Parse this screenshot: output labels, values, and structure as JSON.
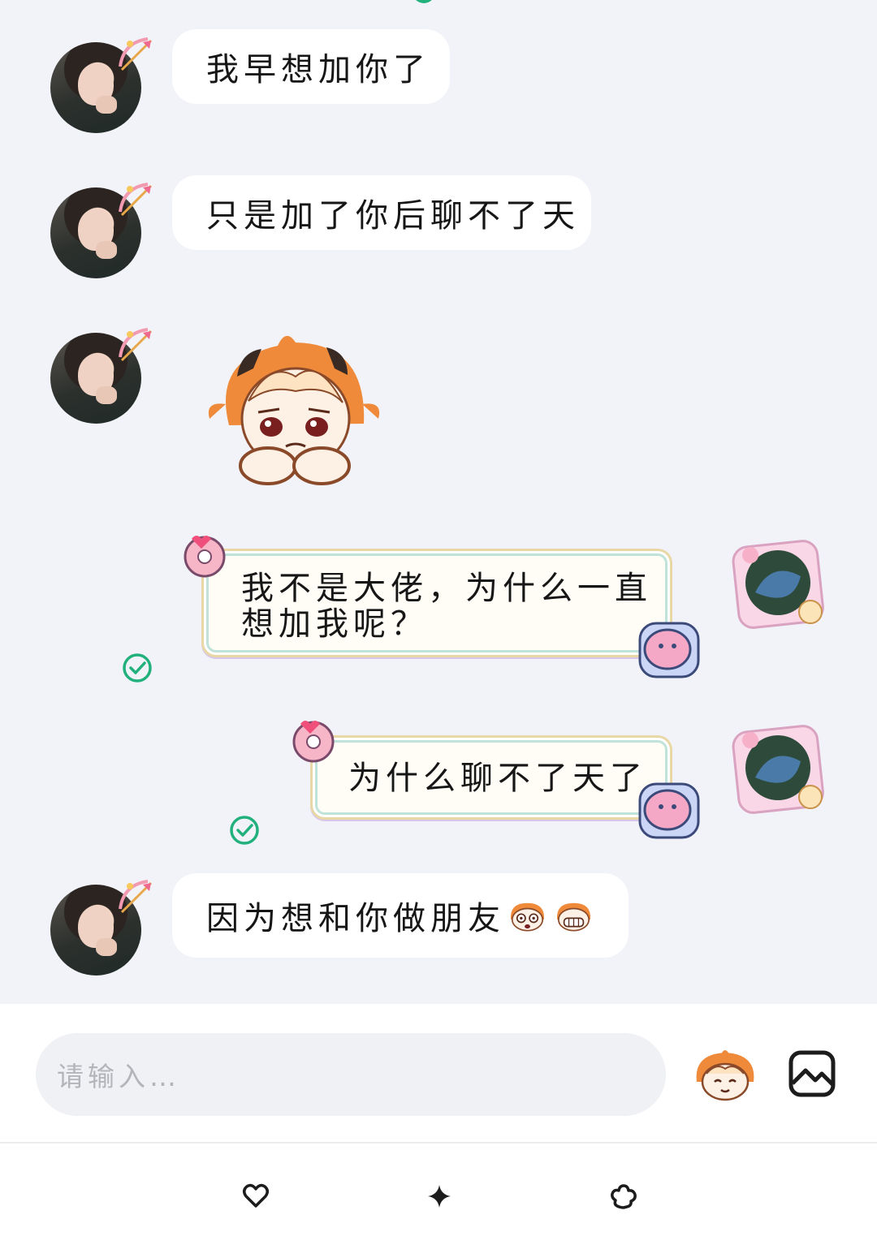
{
  "messages": [
    {
      "side": "left",
      "type": "text",
      "text": "我早想加你了"
    },
    {
      "side": "left",
      "type": "text",
      "text": "只是加了你后聊不了天"
    },
    {
      "side": "left",
      "type": "sticker",
      "sticker": "sad-orange-hair-girl-sticker"
    },
    {
      "side": "right",
      "type": "text",
      "text_line1": "我不是大佬，为什么一直",
      "text_line2": "想加我呢？",
      "status": "read"
    },
    {
      "side": "right",
      "type": "text",
      "text": "为什么聊不了天了",
      "status": "read"
    },
    {
      "side": "left",
      "type": "text",
      "text": "因为想和你做朋友",
      "emojis": [
        "surprised-face-emoji",
        "grinning-face-emoji"
      ]
    }
  ],
  "input": {
    "placeholder": "请输入…"
  },
  "toolbar": {
    "emoji_icon": "emoji-sticker-icon",
    "image_icon": "image-icon"
  },
  "tabbar": {
    "icons": [
      "heart-icon",
      "sparkle-icon",
      "flower-icon"
    ]
  },
  "colors": {
    "background": "#f2f3f8",
    "check": "#22b07d",
    "bubble": "#ffffff"
  }
}
